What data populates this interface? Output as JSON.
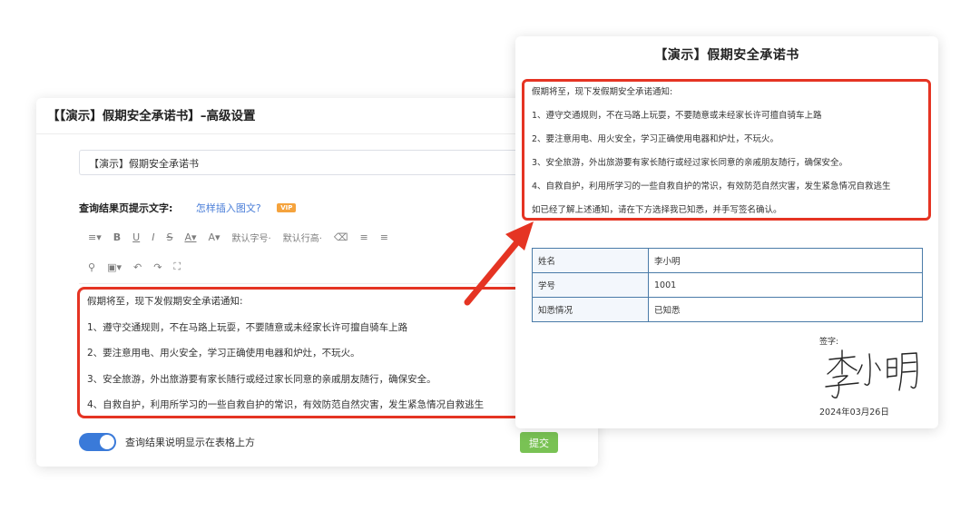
{
  "settings": {
    "title": "【【演示】假期安全承诺书】–高级设置",
    "name_value": "【演示】假期安全承诺书",
    "hint_label": "查询结果页提示文字:",
    "hint_link": "怎样插入图文?",
    "vip_badge": "VIP",
    "toolbar": {
      "row1": [
        "≡▾",
        "B",
        "U",
        "I",
        "S",
        "A▾",
        "A▾",
        "默认字号·",
        "默认行高·",
        "⌫",
        "≡",
        "≡"
      ],
      "row2": [
        "⚲",
        "▣▾",
        "↶",
        "↷",
        "⛶"
      ]
    },
    "editor_lines": [
      "假期将至，现下发假期安全承诺通知:",
      "1、遵守交通规则，不在马路上玩耍，不要随意或未经家长许可擅自骑车上路",
      "2、要注意用电、用火安全，学习正确使用电器和炉灶，不玩火。",
      "3、安全旅游，外出旅游要有家长随行或经过家长同意的亲戚朋友随行，确保安全。",
      "4、自救自护，利用所学习的一些自救自护的常识，有效防范自然灾害，发生紧急情况自救逃生"
    ],
    "toggle_label": "查询结果说明显示在表格上方",
    "toggle_on": true,
    "submit_label": "提交"
  },
  "preview": {
    "title": "【演示】假期安全承诺书",
    "notice_lines": [
      "假期将至，现下发假期安全承诺通知:",
      "1、遵守交通规则，不在马路上玩耍，不要随意或未经家长许可擅自骑车上路",
      "2、要注意用电、用火安全，学习正确使用电器和炉灶，不玩火。",
      "3、安全旅游，外出旅游要有家长随行或经过家长同意的亲戚朋友随行，确保安全。",
      "4、自救自护，利用所学习的一些自救自护的常识，有效防范自然灾害，发生紧急情况自救逃生",
      "如已经了解上述通知，请在下方选择我已知悉，并手写签名确认。"
    ],
    "table": [
      {
        "key": "姓名",
        "value": "李小明"
      },
      {
        "key": "学号",
        "value": "1001"
      },
      {
        "key": "知悉情况",
        "value": "已知悉"
      }
    ],
    "sign_label": "签字:",
    "signature_text": "李小明",
    "date": "2024年03月26日"
  },
  "colors": {
    "highlight": "#e53423",
    "toggle": "#3a7ad9",
    "submit": "#79c254",
    "link": "#4a7ed8",
    "vip": "#f5a33d"
  }
}
